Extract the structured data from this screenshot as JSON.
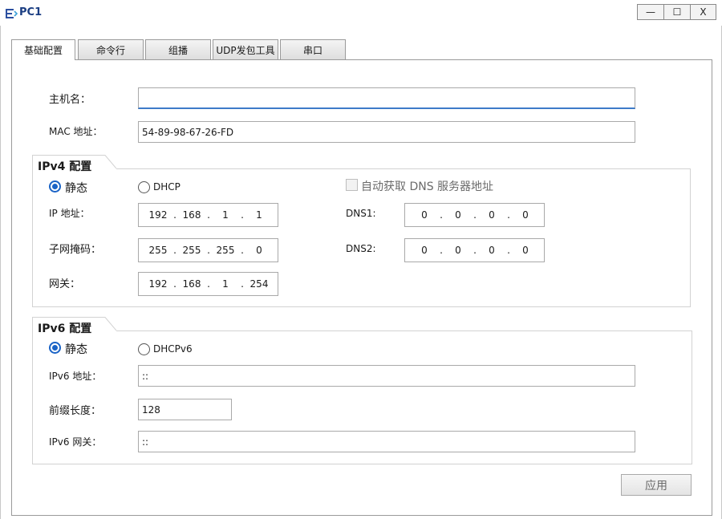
{
  "window": {
    "title": "PC1",
    "minimize_glyph": "—",
    "maximize_glyph": "☐",
    "close_glyph": "X",
    "icon": "pc-app-icon"
  },
  "tabs": [
    {
      "label": "基础配置",
      "active": true
    },
    {
      "label": "命令行",
      "active": false
    },
    {
      "label": "组播",
      "active": false
    },
    {
      "label": "UDP发包工具",
      "active": false
    },
    {
      "label": "串口",
      "active": false
    }
  ],
  "basic": {
    "hostname_label": "主机名：",
    "hostname_value": "",
    "mac_label": "MAC 地址：",
    "mac_value": "54-89-98-67-26-FD"
  },
  "ipv4": {
    "group_title": "IPv4 配置",
    "static_label": "静态",
    "dhcp_label": "DHCP",
    "auto_dns_label": "自动获取 DNS 服务器地址",
    "ip_label": "IP 地址：",
    "ip": [
      "192",
      "168",
      "1",
      "1"
    ],
    "mask_label": "子网掩码：",
    "mask": [
      "255",
      "255",
      "255",
      "0"
    ],
    "gateway_label": "网关：",
    "gateway": [
      "192",
      "168",
      "1",
      "254"
    ],
    "dns1_label": "DNS1:",
    "dns1": [
      "0",
      "0",
      "0",
      "0"
    ],
    "dns2_label": "DNS2:",
    "dns2": [
      "0",
      "0",
      "0",
      "0"
    ]
  },
  "ipv6": {
    "group_title": "IPv6 配置",
    "static_label": "静态",
    "dhcp_label": "DHCPv6",
    "addr_label": "IPv6 地址：",
    "addr_value": "::",
    "prefix_label": "前缀长度：",
    "prefix_value": "128",
    "gateway_label": "IPv6 网关：",
    "gateway_value": "::"
  },
  "apply_label": "应用",
  "colors": {
    "accent": "#1a63c6",
    "title_text": "#1a3d82",
    "focus_border": "#3d7bc9"
  }
}
